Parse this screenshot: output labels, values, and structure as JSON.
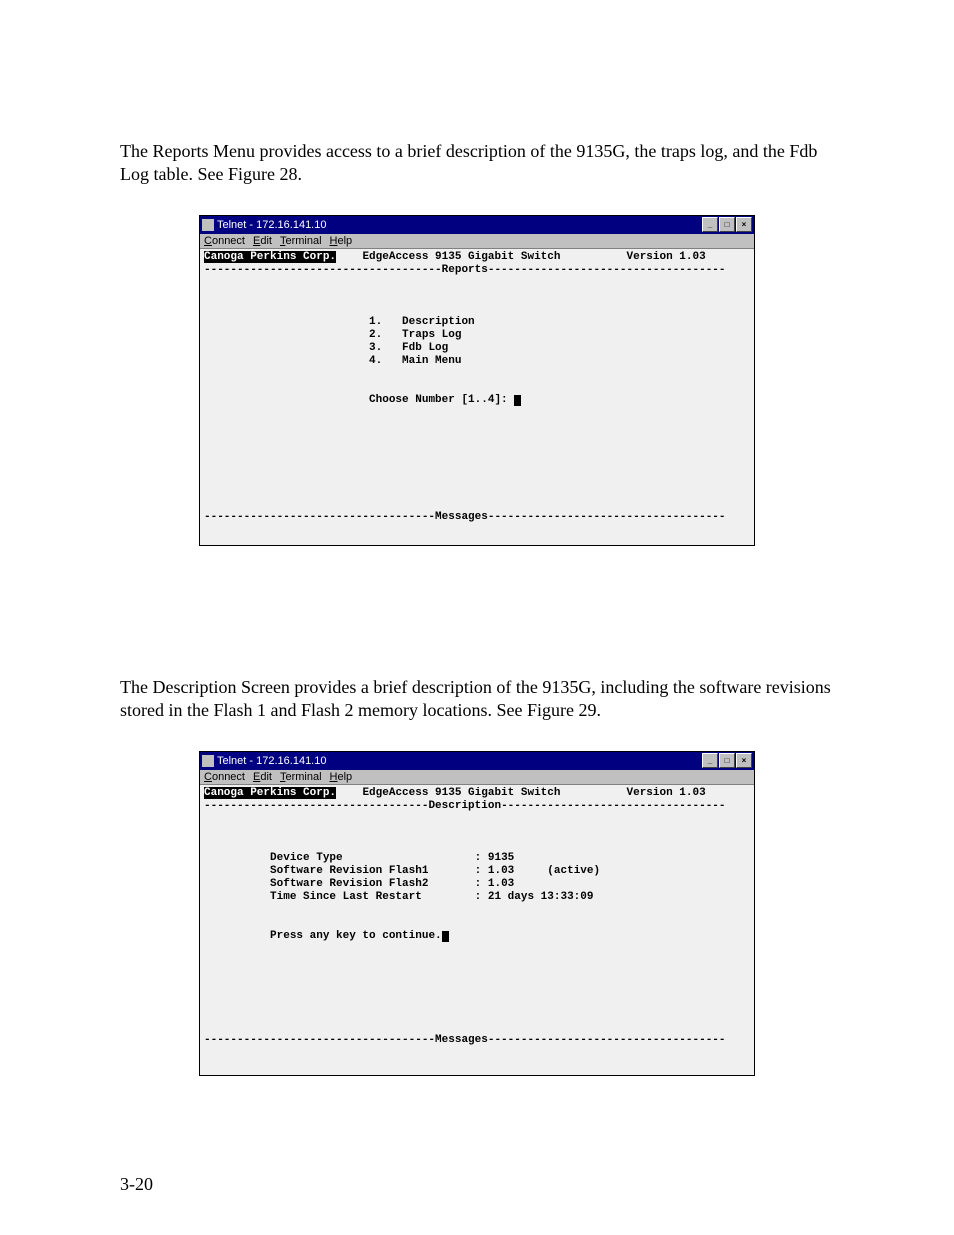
{
  "paragraphs": {
    "p1": "The Reports Menu provides access to a brief description of the 9135G, the traps log, and the Fdb Log table. See Figure 28.",
    "p2": "The Description Screen provides a brief description of the 9135G, including the software revisions stored in the Flash 1 and Flash 2 memory locations. See Figure 29."
  },
  "pageNumber": "3-20",
  "window": {
    "title": "Telnet - 172.16.141.10",
    "menu": {
      "connect": "Connect",
      "edit": "Edit",
      "terminal": "Terminal",
      "help": "Help"
    }
  },
  "screen1": {
    "header_left": "Canoga Perkins Corp.",
    "header_center": "EdgeAccess 9135 Gigabit Switch",
    "header_right": "Version 1.03",
    "section_title": "Reports",
    "menu_items": [
      {
        "num": "1.",
        "label": "Description"
      },
      {
        "num": "2.",
        "label": "Traps Log"
      },
      {
        "num": "3.",
        "label": "Fdb Log"
      },
      {
        "num": "4.",
        "label": "Main Menu"
      }
    ],
    "prompt": "Choose Number [1..4]: ",
    "messages_title": "Messages"
  },
  "screen2": {
    "header_left": "Canoga Perkins Corp.",
    "header_center": "EdgeAccess 9135 Gigabit Switch",
    "header_right": "Version 1.03",
    "section_title": "Description",
    "fields": [
      {
        "label": "Device Type",
        "value": "9135",
        "extra": ""
      },
      {
        "label": "Software Revision Flash1",
        "value": "1.03",
        "extra": "(active)"
      },
      {
        "label": "Software Revision Flash2",
        "value": "1.03",
        "extra": ""
      },
      {
        "label": "Time Since Last Restart",
        "value": "21 days 13:33:09",
        "extra": ""
      }
    ],
    "prompt": "Press any key to continue.",
    "messages_title": "Messages"
  }
}
